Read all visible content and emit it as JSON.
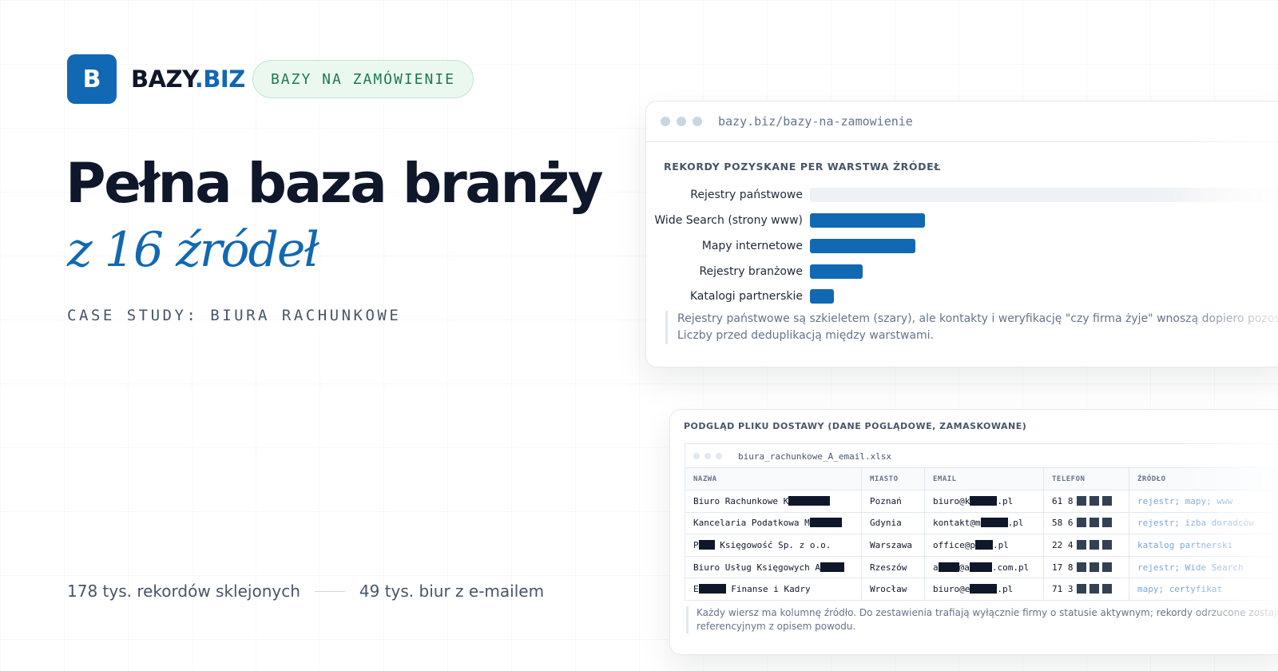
{
  "brand": {
    "logo_letter": "B",
    "name_main": "BAZY",
    "name_suffix": ".BIZ",
    "tag": "BAZY NA ZAMÓWIENIE",
    "accent": "#1168b3"
  },
  "hero": {
    "headline": "Pełna baza branży",
    "subheadline": "z 16 źródeł",
    "case_study": "CASE STUDY: BIURA RACHUNKOWE"
  },
  "stats": {
    "records": "178 tys. rekordów sklejonych",
    "emails": "49 tys. biur z e-mailem"
  },
  "browser": {
    "url": "bazy.biz/bazy-na-zamowienie"
  },
  "chart_data": {
    "type": "bar",
    "title": "REKORDY POZYSKANE PER WARSTWA ŹRÓDEŁ",
    "categories": [
      "Rejestry państwowe",
      "Wide Search (strony www)",
      "Mapy internetowe",
      "Rejestry branżowe",
      "Katalogi partnerskie"
    ],
    "values": [
      100,
      24,
      22,
      11,
      5
    ],
    "value_unit": "relative",
    "highlight": [
      false,
      true,
      true,
      true,
      true
    ],
    "colors": {
      "primary": "#1168b3",
      "muted": "#eef1f5"
    },
    "note_line1": "Rejestry państwowe są szkieletem (szary), ale kontakty i weryfikację \"czy firma żyje\" wnoszą dopiero pozostałe.",
    "note_line2": "Liczby przed deduplikacją między warstwami."
  },
  "preview": {
    "title": "PODGLĄD PLIKU DOSTAWY (DANE POGLĄDOWE, ZAMASKOWANE)",
    "file_name": "biura_rachunkowe_A_email.xlsx",
    "columns": [
      "NAZWA",
      "MIASTO",
      "EMAIL",
      "TELEFON",
      "ŹRÓDŁO"
    ],
    "rows": [
      {
        "name_a": "Biuro Rachunkowe K",
        "name_b": "",
        "city": "Poznań",
        "email_a": "biuro@k",
        "email_b": ".pl",
        "phone": "61 8",
        "source": "rejestr; mapy; www"
      },
      {
        "name_a": "Kancelaria Podatkowa M",
        "name_b": "",
        "city": "Gdynia",
        "email_a": "kontakt@m",
        "email_b": ".pl",
        "phone": "58 6",
        "source": "rejestr; izba doradców"
      },
      {
        "name_a": "P",
        "name_b": " Księgowość Sp. z o.o.",
        "city": "Warszawa",
        "email_a": "office@p",
        "email_b": ".pl",
        "phone": "22 4",
        "source": "katalog partnerski"
      },
      {
        "name_a": "Biuro Usług Księgowych A",
        "name_b": "",
        "city": "Rzeszów",
        "email_a": "a",
        "email_mid": "@a",
        "email_b": ".com.pl",
        "phone": "17 8",
        "source": "rejestr; Wide Search"
      },
      {
        "name_a": "E",
        "name_b": " Finanse i Kadry",
        "city": "Wrocław",
        "email_a": "biuro@e",
        "email_b": ".pl",
        "phone": "71 3",
        "source": "mapy; certyfikat"
      }
    ],
    "note_line1": "Każdy wiersz ma kolumnę źródło. Do zestawienia trafiają wyłącznie firmy o statusie aktywnym; rekordy odrzucone zostają w pliku",
    "note_line2": "referencyjnym z opisem powodu."
  }
}
